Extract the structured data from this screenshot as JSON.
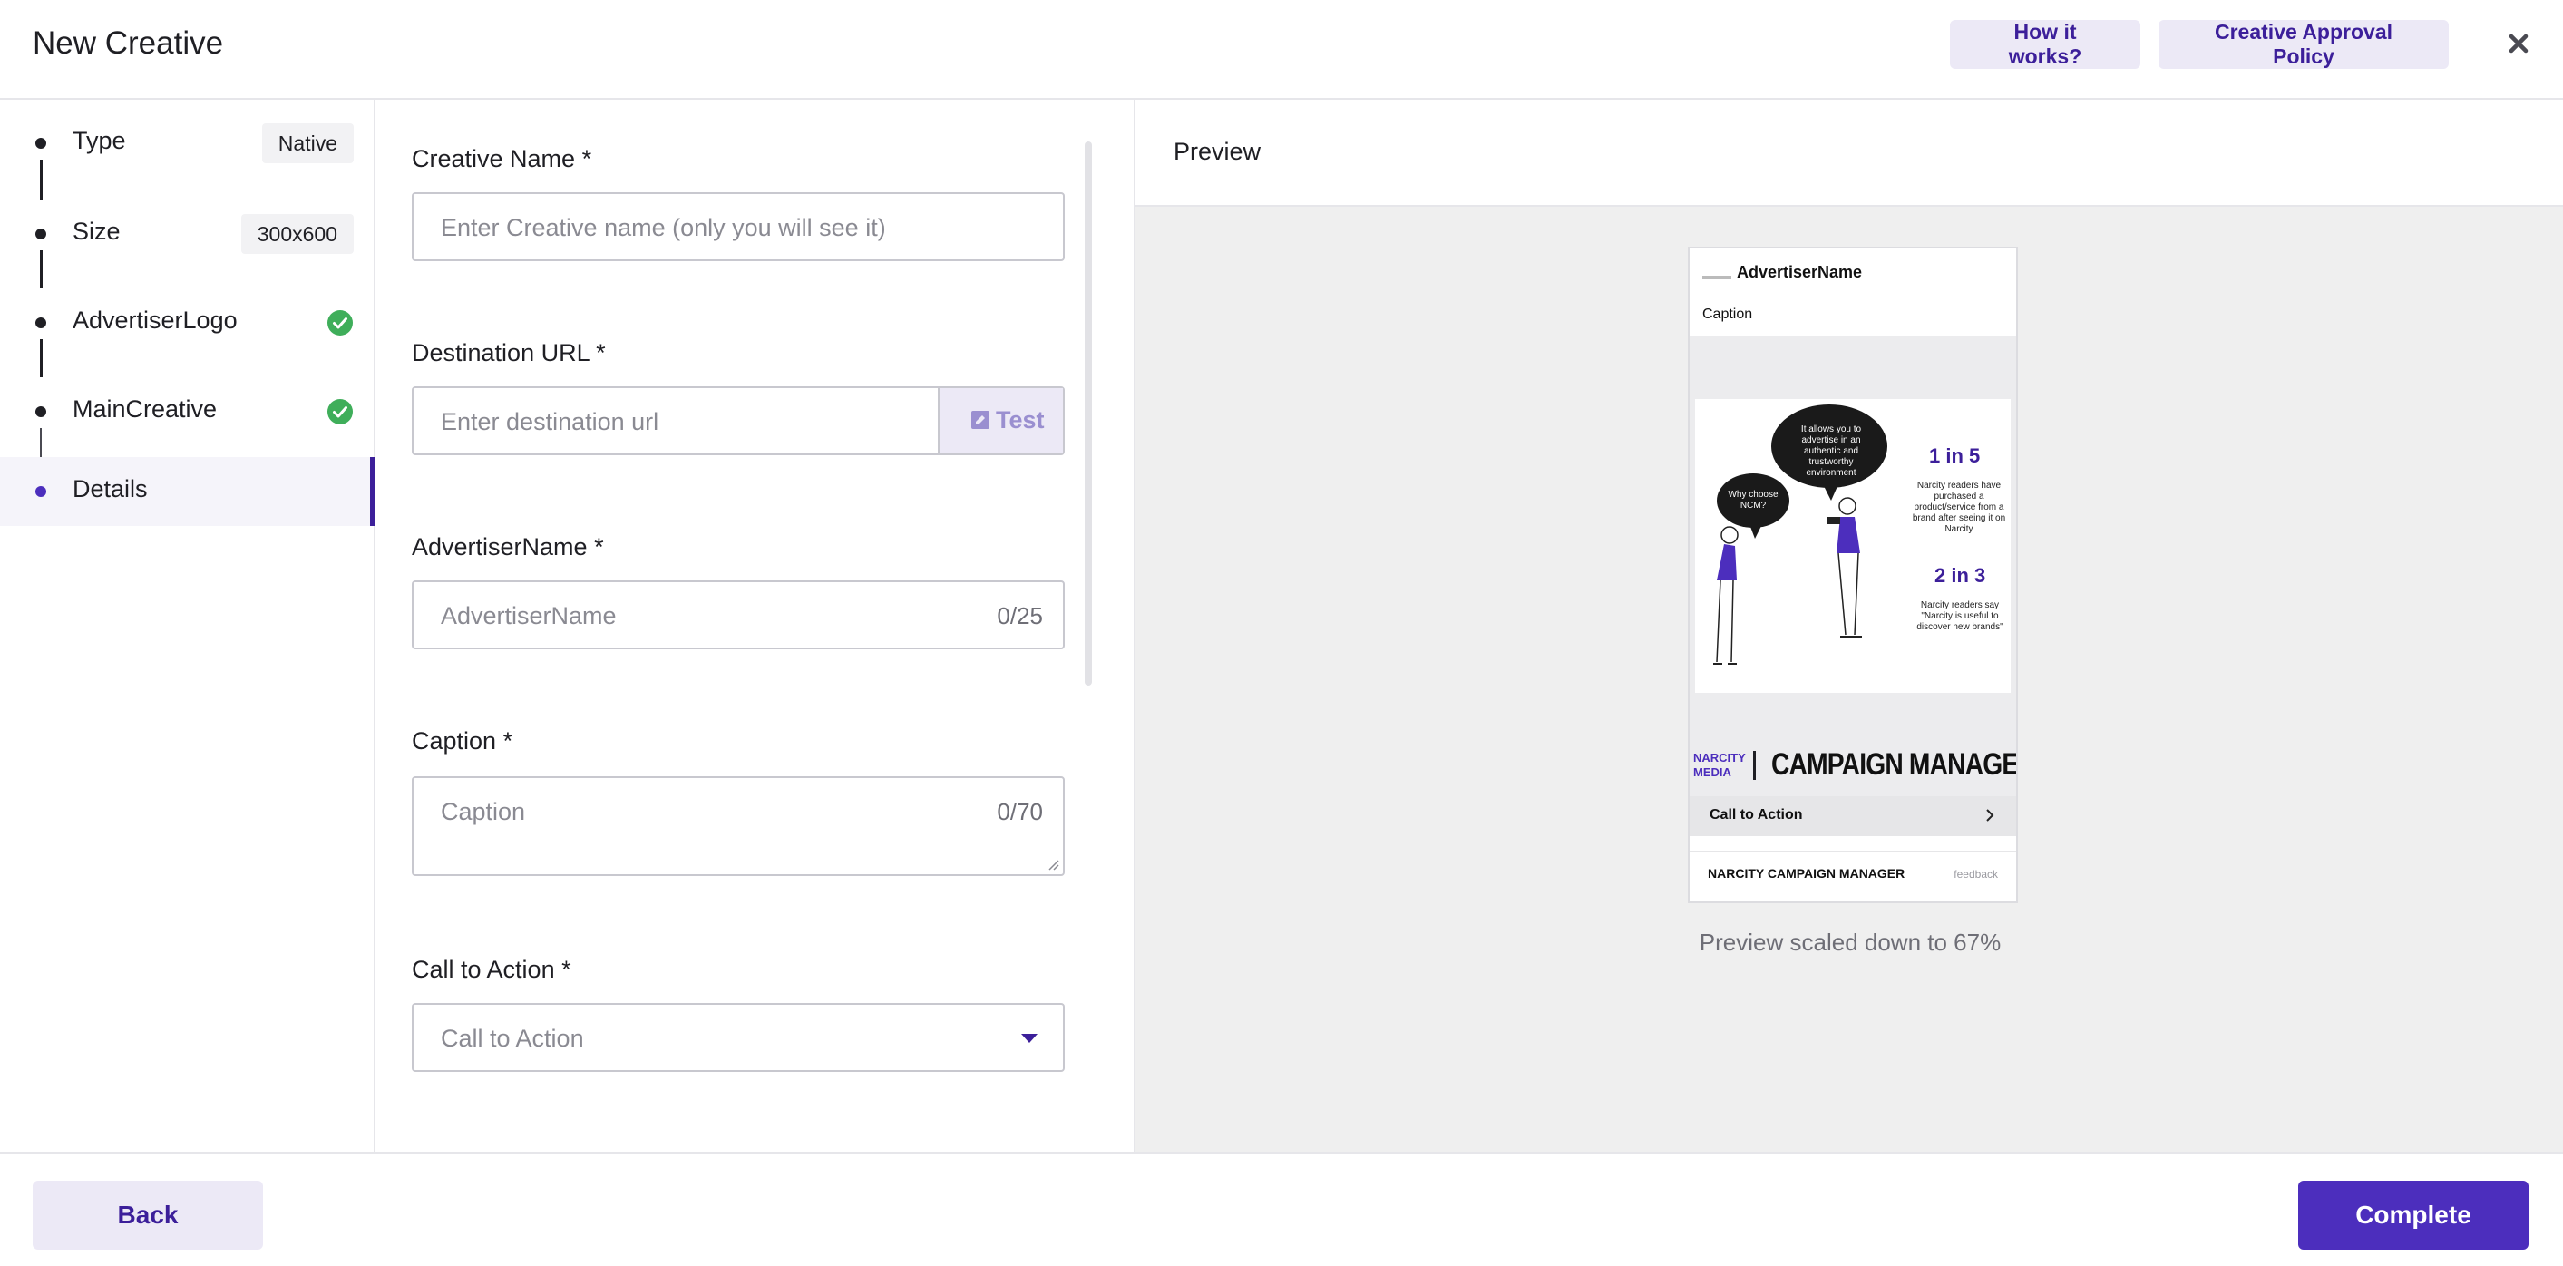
{
  "header": {
    "title": "New Creative",
    "how_it_works": "How it works?",
    "approval_policy": "Creative Approval Policy"
  },
  "steps": [
    {
      "label": "Type",
      "tag": "Native"
    },
    {
      "label": "Size",
      "tag": "300x600"
    },
    {
      "label": "AdvertiserLogo",
      "status": "complete"
    },
    {
      "label": "MainCreative",
      "status": "complete"
    },
    {
      "label": "Details",
      "status": "active"
    }
  ],
  "form": {
    "creative_name": {
      "label": "Creative Name *",
      "placeholder": "Enter Creative name (only you will see it)"
    },
    "destination_url": {
      "label": "Destination URL *",
      "placeholder": "Enter destination url",
      "test_label": "Test"
    },
    "advertiser_name": {
      "label": "AdvertiserName *",
      "placeholder": "AdvertiserName",
      "count": "0/25"
    },
    "caption": {
      "label": "Caption *",
      "placeholder": "Caption",
      "count": "0/70"
    },
    "call_to_action": {
      "label": "Call to Action *",
      "placeholder": "Call to Action"
    }
  },
  "preview": {
    "title": "Preview",
    "card": {
      "advertiser": "AdvertiserName",
      "caption": "Caption",
      "bubble_large": "It allows you to advertise in an authentic and trustworthy environment",
      "bubble_small": "Why choose NCM?",
      "stat1": "1 in 5",
      "stat1_text": "Narcity readers have purchased a product/service from a brand after seeing it on Narcity",
      "stat2": "2 in 3",
      "stat2_text": "Narcity readers say \"Narcity is useful to discover new brands\"",
      "brand_small": "NARCITY MEDIA",
      "brand_large": "CAMPAIGN MANAGER",
      "cta": "Call to Action",
      "footer_label": "NARCITY CAMPAIGN MANAGER",
      "feedback": "feedback"
    },
    "scaled_note": "Preview scaled down to 67%"
  },
  "footer": {
    "back": "Back",
    "complete": "Complete"
  },
  "colors": {
    "accent": "#4c2ebd",
    "accent_dark": "#3c1f9a",
    "accent_soft": "#ece9f6",
    "success": "#3fae5a"
  },
  "icons": [
    "close-icon",
    "check-circle-icon",
    "edit-icon",
    "chevron-down-icon",
    "chevron-right-icon"
  ]
}
